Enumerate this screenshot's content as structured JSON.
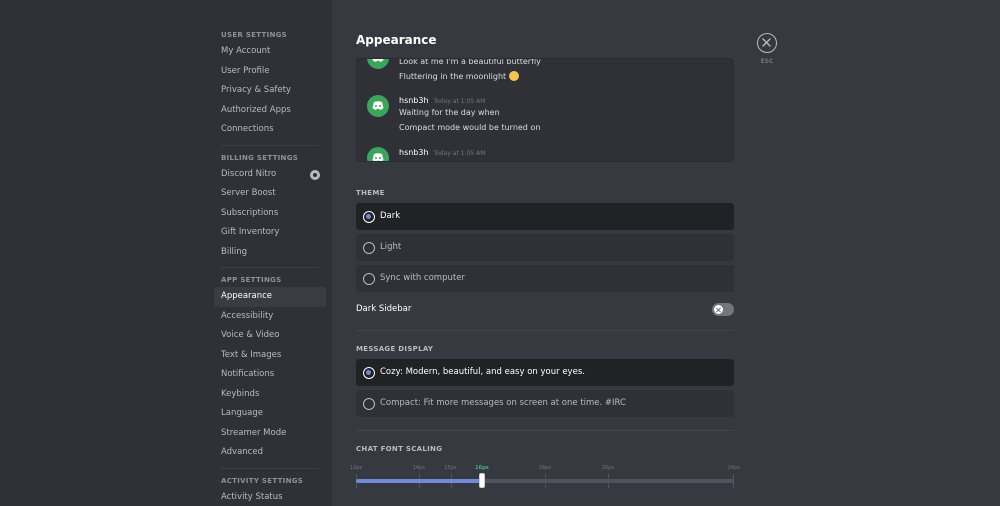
{
  "sidebar": {
    "sections": [
      {
        "header": "USER SETTINGS",
        "items": [
          "My Account",
          "User Profile",
          "Privacy & Safety",
          "Authorized Apps",
          "Connections"
        ]
      },
      {
        "header": "BILLING SETTINGS",
        "items": [
          "Discord Nitro",
          "Server Boost",
          "Subscriptions",
          "Gift Inventory",
          "Billing"
        ]
      },
      {
        "header": "APP SETTINGS",
        "items": [
          "Appearance",
          "Accessibility",
          "Voice & Video",
          "Text & Images",
          "Notifications",
          "Keybinds",
          "Language",
          "Streamer Mode",
          "Advanced"
        ]
      },
      {
        "header": "ACTIVITY SETTINGS",
        "items": [
          "Activity Status"
        ]
      }
    ],
    "selected": "Appearance"
  },
  "page": {
    "title": "Appearance"
  },
  "preview": {
    "messages": [
      {
        "lines": [
          "Look at me I'm a beautiful butterfly",
          "Fluttering in the moonlight"
        ]
      },
      {
        "author": "hsnb3h",
        "time": "Today at 1:05 AM",
        "lines": [
          "Waiting for the day when",
          "Compact mode would be turned on"
        ]
      },
      {
        "author": "hsnb3h",
        "time": "Today at 1:05 AM",
        "lines": []
      }
    ]
  },
  "theme": {
    "label": "THEME",
    "options": [
      "Dark",
      "Light",
      "Sync with computer"
    ],
    "selected": "Dark"
  },
  "dark_sidebar": {
    "label": "Dark Sidebar",
    "enabled": false
  },
  "message_display": {
    "label": "MESSAGE DISPLAY",
    "options": [
      "Cozy: Modern, beautiful, and easy on your eyes.",
      "Compact: Fit more messages on screen at one time. #IRC"
    ],
    "selected": "Cozy: Modern, beautiful, and easy on your eyes."
  },
  "font_scaling": {
    "label": "CHAT FONT SCALING",
    "ticks": [
      "12px",
      "14px",
      "15px",
      "16px",
      "18px",
      "20px",
      "24px"
    ],
    "tick_values": [
      12,
      14,
      15,
      16,
      18,
      20,
      24
    ],
    "value": 16,
    "min": 12,
    "max": 24,
    "accent": "#7289da",
    "active_tick_color": "#43b581"
  },
  "close": {
    "label": "ESC"
  },
  "colors": {
    "background": "#36393f",
    "sidebar": "#2f3136",
    "accent": "#7289da",
    "avatar": "#3ba55c"
  }
}
